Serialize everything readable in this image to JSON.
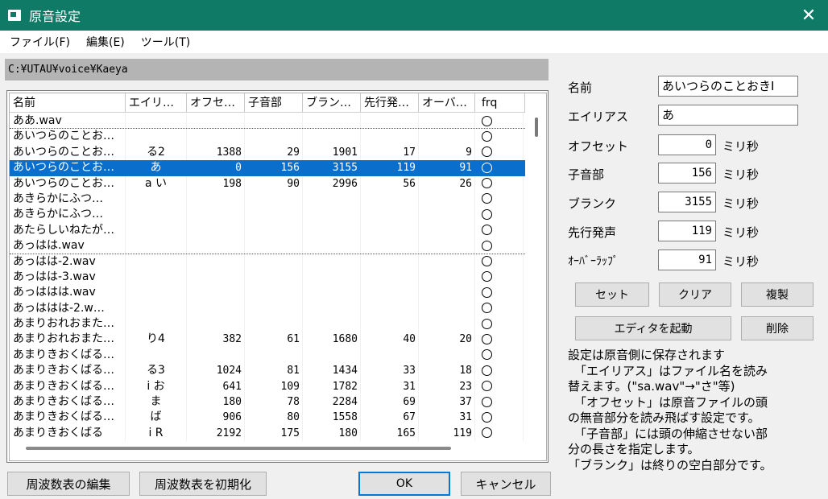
{
  "window": {
    "title": "原音設定",
    "close_glyph": "✕"
  },
  "menu": [
    {
      "label": "ファイル(F)"
    },
    {
      "label": "編集(E)"
    },
    {
      "label": "ツール(T)"
    }
  ],
  "path": "C:¥UTAU¥voice¥Kaeya",
  "table": {
    "columns": [
      "名前",
      "エイリ…",
      "オフセ…",
      "子音部",
      "ブラン…",
      "先行発…",
      "オーバ…",
      "frq"
    ],
    "rows": [
      {
        "name": "ああ.wav",
        "alias": "",
        "offset": "",
        "consonant": "",
        "blank": "",
        "preutter": "",
        "overlap": "",
        "frq": true,
        "dotted": true,
        "selected": false
      },
      {
        "name": "あいつらのことお…",
        "alias": "",
        "offset": "",
        "consonant": "",
        "blank": "",
        "preutter": "",
        "overlap": "",
        "frq": true,
        "dotted": false,
        "selected": false
      },
      {
        "name": "あいつらのことお…",
        "alias": "る2",
        "offset": "1388",
        "consonant": "29",
        "blank": "1901",
        "preutter": "17",
        "overlap": "9",
        "frq": true,
        "dotted": false,
        "selected": false
      },
      {
        "name": "あいつらのことお…",
        "alias": "あ",
        "offset": "0",
        "consonant": "156",
        "blank": "3155",
        "preutter": "119",
        "overlap": "91",
        "frq": true,
        "dotted": false,
        "selected": true
      },
      {
        "name": "あいつらのことお…",
        "alias": "a い",
        "offset": "198",
        "consonant": "90",
        "blank": "2996",
        "preutter": "56",
        "overlap": "26",
        "frq": true,
        "dotted": false,
        "selected": false
      },
      {
        "name": "あきらかにふつ…",
        "alias": "",
        "offset": "",
        "consonant": "",
        "blank": "",
        "preutter": "",
        "overlap": "",
        "frq": true,
        "dotted": false,
        "selected": false
      },
      {
        "name": "あきらかにふつ…",
        "alias": "",
        "offset": "",
        "consonant": "",
        "blank": "",
        "preutter": "",
        "overlap": "",
        "frq": true,
        "dotted": false,
        "selected": false
      },
      {
        "name": "あたらしいねたが…",
        "alias": "",
        "offset": "",
        "consonant": "",
        "blank": "",
        "preutter": "",
        "overlap": "",
        "frq": true,
        "dotted": false,
        "selected": false
      },
      {
        "name": "あっはは.wav",
        "alias": "",
        "offset": "",
        "consonant": "",
        "blank": "",
        "preutter": "",
        "overlap": "",
        "frq": true,
        "dotted": true,
        "selected": false
      },
      {
        "name": "あっはは-2.wav",
        "alias": "",
        "offset": "",
        "consonant": "",
        "blank": "",
        "preutter": "",
        "overlap": "",
        "frq": true,
        "dotted": false,
        "selected": false
      },
      {
        "name": "あっはは-3.wav",
        "alias": "",
        "offset": "",
        "consonant": "",
        "blank": "",
        "preutter": "",
        "overlap": "",
        "frq": true,
        "dotted": false,
        "selected": false
      },
      {
        "name": "あっははは.wav",
        "alias": "",
        "offset": "",
        "consonant": "",
        "blank": "",
        "preutter": "",
        "overlap": "",
        "frq": true,
        "dotted": false,
        "selected": false
      },
      {
        "name": "あっははは-2.w…",
        "alias": "",
        "offset": "",
        "consonant": "",
        "blank": "",
        "preutter": "",
        "overlap": "",
        "frq": true,
        "dotted": false,
        "selected": false
      },
      {
        "name": "あまりおれおまた…",
        "alias": "",
        "offset": "",
        "consonant": "",
        "blank": "",
        "preutter": "",
        "overlap": "",
        "frq": true,
        "dotted": false,
        "selected": false
      },
      {
        "name": "あまりおれおまた…",
        "alias": "り4",
        "offset": "382",
        "consonant": "61",
        "blank": "1680",
        "preutter": "40",
        "overlap": "20",
        "frq": true,
        "dotted": false,
        "selected": false
      },
      {
        "name": "あまりきおくばる…",
        "alias": "",
        "offset": "",
        "consonant": "",
        "blank": "",
        "preutter": "",
        "overlap": "",
        "frq": true,
        "dotted": false,
        "selected": false
      },
      {
        "name": "あまりきおくばる…",
        "alias": "る3",
        "offset": "1024",
        "consonant": "81",
        "blank": "1434",
        "preutter": "33",
        "overlap": "18",
        "frq": true,
        "dotted": false,
        "selected": false
      },
      {
        "name": "あまりきおくばる…",
        "alias": "i お",
        "offset": "641",
        "consonant": "109",
        "blank": "1782",
        "preutter": "31",
        "overlap": "23",
        "frq": true,
        "dotted": false,
        "selected": false
      },
      {
        "name": "あまりきおくばる…",
        "alias": "ま",
        "offset": "180",
        "consonant": "78",
        "blank": "2284",
        "preutter": "69",
        "overlap": "37",
        "frq": true,
        "dotted": false,
        "selected": false
      },
      {
        "name": "あまりきおくばる…",
        "alias": "ば",
        "offset": "906",
        "consonant": "80",
        "blank": "1558",
        "preutter": "67",
        "overlap": "31",
        "frq": true,
        "dotted": false,
        "selected": false
      },
      {
        "name": "あまりきおくばる",
        "alias": "i R",
        "offset": "2192",
        "consonant": "175",
        "blank": "180",
        "preutter": "165",
        "overlap": "119",
        "frq": true,
        "dotted": false,
        "selected": false
      }
    ]
  },
  "form": {
    "name_label": "名前",
    "name_value": "あいつらのことおきI",
    "alias_label": "エイリアス",
    "alias_value": "あ",
    "offset_label": "オフセット",
    "offset_value": "0",
    "consonant_label": "子音部",
    "consonant_value": "156",
    "blank_label": "ブランク",
    "blank_value": "3155",
    "preutter_label": "先行発声",
    "preutter_value": "119",
    "overlap_label": "ｵｰﾊﾞｰﾗｯﾌﾟ",
    "overlap_value": "91",
    "unit": "ミリ秒"
  },
  "buttons": {
    "set": "セット",
    "clear": "クリア",
    "duplicate": "複製",
    "launch_editor": "エディタを起動",
    "delete": "削除",
    "edit_freq": "周波数表の編集",
    "init_freq": "周波数表を初期化",
    "ok": "OK",
    "cancel": "キャンセル"
  },
  "info": [
    "設定は原音側に保存されます",
    "「エイリアス」はファイル名を読み",
    "替えます。(\"sa.wav\"→\"さ\"等)",
    "「オフセット」は原音ファイルの頭",
    "の無音部分を読み飛ばす設定です。",
    "「子音部」には頭の伸縮させない部",
    "分の長さを指定します。",
    "「ブランク」は終りの空白部分です。"
  ]
}
